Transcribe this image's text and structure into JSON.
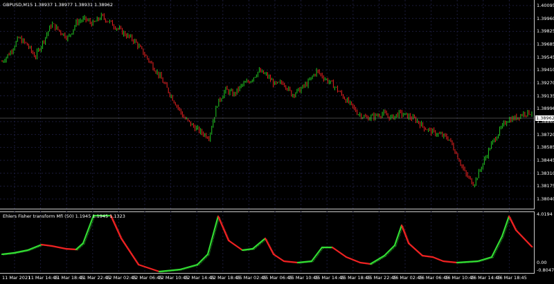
{
  "main_chart": {
    "title": "GBPUSD,M15  1.38937 1.38977 1.38931 1.38962",
    "price_labels": [
      "1.40095",
      "1.39960",
      "1.39825",
      "1.39685",
      "1.39545",
      "1.39410",
      "1.39270",
      "1.39135",
      "1.38996",
      "1.38860",
      "1.38720",
      "1.38585",
      "1.38445",
      "1.38310",
      "1.38175",
      "1.38040"
    ],
    "current_price": "1.38962",
    "colors": {
      "up": "#22cc22",
      "down": "#ee2222",
      "grid": "#1c1c3c",
      "current_line": "#888888"
    }
  },
  "indicator": {
    "title": "Ehlers Fisher transform Mfi (50) 1.1945 1.1945 1.1323",
    "scale_labels": [
      "4.0194",
      "0.00",
      "-0.8047"
    ],
    "colors": {
      "up": "#33dd33",
      "down": "#ee2222"
    }
  },
  "time_axis": [
    "11 Mar 2021",
    "11 Mar 14:45",
    "11 Mar 18:45",
    "11 Mar 22:45",
    "12 Mar 02:45",
    "12 Mar 06:45",
    "12 Mar 10:45",
    "12 Mar 14:45",
    "12 Mar 18:45",
    "15 Mar 02:45",
    "15 Mar 06:45",
    "15 Mar 10:45",
    "15 Mar 14:45",
    "15 Mar 18:45",
    "15 Mar 22:45",
    "16 Mar 02:45",
    "16 Mar 06:45",
    "16 Mar 10:45",
    "16 Mar 14:45",
    "16 Mar 18:45"
  ],
  "chart_data": {
    "type": "candlestick",
    "title": "GBPUSD,M15  1.38937 1.38977 1.38931 1.38962",
    "close_path": [
      1.395,
      1.396,
      1.3975,
      1.3968,
      1.3955,
      1.3972,
      1.399,
      1.3982,
      1.3975,
      1.3992,
      1.3995,
      1.399,
      1.3998,
      1.3992,
      1.3985,
      1.3978,
      1.3972,
      1.396,
      1.3948,
      1.3935,
      1.392,
      1.3905,
      1.389,
      1.3882,
      1.3875,
      1.387,
      1.3905,
      1.392,
      1.3915,
      1.3925,
      1.393,
      1.394,
      1.3935,
      1.3925,
      1.3928,
      1.3915,
      1.392,
      1.3928,
      1.394,
      1.3932,
      1.3925,
      1.3915,
      1.3905,
      1.3895,
      1.389,
      1.3892,
      1.3895,
      1.389,
      1.3895,
      1.3892,
      1.3888,
      1.388,
      1.3875,
      1.3872,
      1.3868,
      1.385,
      1.383,
      1.382,
      1.384,
      1.386,
      1.3875,
      1.3888,
      1.389,
      1.3895,
      1.3896
    ],
    "ylim": [
      1.3804,
      1.40095
    ]
  }
}
